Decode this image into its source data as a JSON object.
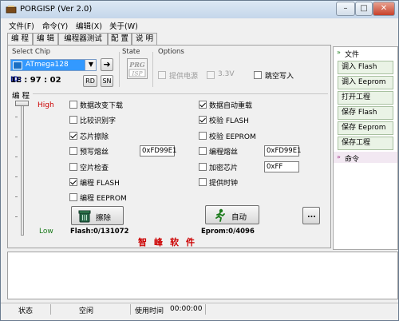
{
  "window": {
    "title": "PORGISP (Ver 2.0)",
    "minimize": "–",
    "maximize": "□",
    "close": "✕"
  },
  "menu": [
    "文件(F)",
    "命令(Y)",
    "编辑(X)",
    "关于(W)"
  ],
  "tabs": [
    "编 程",
    "编 辑",
    "编程器测试",
    "配 置",
    "说 明"
  ],
  "select_chip": {
    "label": "Select Chip",
    "value": "ATmega128",
    "id_label": "ID:",
    "id_value": "1E : 97 : 02",
    "rd": "RD",
    "sn": "SN",
    "go": "➜"
  },
  "state": {
    "label": "State",
    "logo_top": "PRG",
    "logo_bottom": "ISP"
  },
  "options": {
    "label": "Options",
    "power": "提供电源",
    "voltage": "3.3V",
    "skip_write": "跳空写入"
  },
  "program": {
    "label": "编 程",
    "high": "High",
    "low": "Low",
    "left_checks": [
      {
        "label": "数据改变下载",
        "checked": false
      },
      {
        "label": "比较识别字",
        "checked": false
      },
      {
        "label": "芯片擦除",
        "checked": true
      },
      {
        "label": "预写熔丝",
        "checked": false
      },
      {
        "label": "空片检查",
        "checked": false
      },
      {
        "label": "编程 FLASH",
        "checked": true
      },
      {
        "label": "编程 EEPROM",
        "checked": false
      }
    ],
    "right_checks": [
      {
        "label": "数据自动重载",
        "checked": true
      },
      {
        "label": "校验 FLASH",
        "checked": true
      },
      {
        "label": "校验 EEPROM",
        "checked": false
      },
      {
        "label": "编程熔丝",
        "checked": false
      },
      {
        "label": "加密芯片",
        "checked": false
      },
      {
        "label": "提供时钟",
        "checked": false
      }
    ],
    "prewrite_fuse_value": "0xFD99E1",
    "program_fuse_value": "0xFD99E1",
    "lock_value": "0xFF",
    "erase_button": "擦除",
    "auto_button": "自动",
    "more_button": "...",
    "flash_status": "Flash:0/131072",
    "eprom_status": "Eprom:0/4096",
    "brand": "智峰软件"
  },
  "sidebar": {
    "file_header": "文件",
    "items": [
      "调入 Flash",
      "调入 Eeprom",
      "打开工程",
      "保存 Flash",
      "保存 Eeprom",
      "保存工程"
    ],
    "command_header": "命令"
  },
  "statusbar": {
    "state_label": "状态",
    "state_value": "空闲",
    "time_label": "使用时间",
    "time_value": "00:00:00"
  },
  "colors": {
    "brand": "#cc0000",
    "high": "#cc0000",
    "low": "#1a7a1a",
    "selection": "#3399ff"
  }
}
